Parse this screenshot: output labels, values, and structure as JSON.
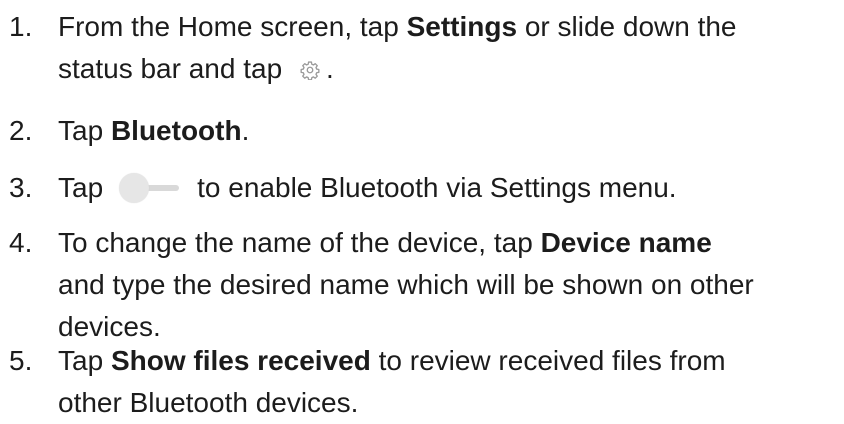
{
  "steps": [
    {
      "number": "1.",
      "l1_a": "From the Home screen, tap ",
      "l1_bold": "Settings",
      "l1_b": " or slide down the",
      "l2_a": "status bar and tap ",
      "l2_icon": "gear-icon",
      "l2_b": "."
    },
    {
      "number": "2.",
      "l1_a": "Tap ",
      "l1_bold": "Bluetooth",
      "l1_b": "."
    },
    {
      "number": "3.",
      "l1_a": "Tap",
      "l1_icon": "toggle-switch-off-icon",
      "l1_b": "to enable Bluetooth via Settings menu."
    },
    {
      "number": "4.",
      "l1_a": "To change the name of the device, tap ",
      "l1_bold": "Device name",
      "l2": "and type the desired name which will be shown on other",
      "l3": "devices."
    },
    {
      "number": "5.",
      "l1_a": "Tap ",
      "l1_bold": "Show files received",
      "l1_b": " to review received files from",
      "l2": "other Bluetooth devices."
    }
  ],
  "colors": {
    "text": "#1c1c1c",
    "icon": "#9a9a9a",
    "toggle_knob": "#e6e6e6",
    "toggle_track": "#d9d9d9"
  }
}
